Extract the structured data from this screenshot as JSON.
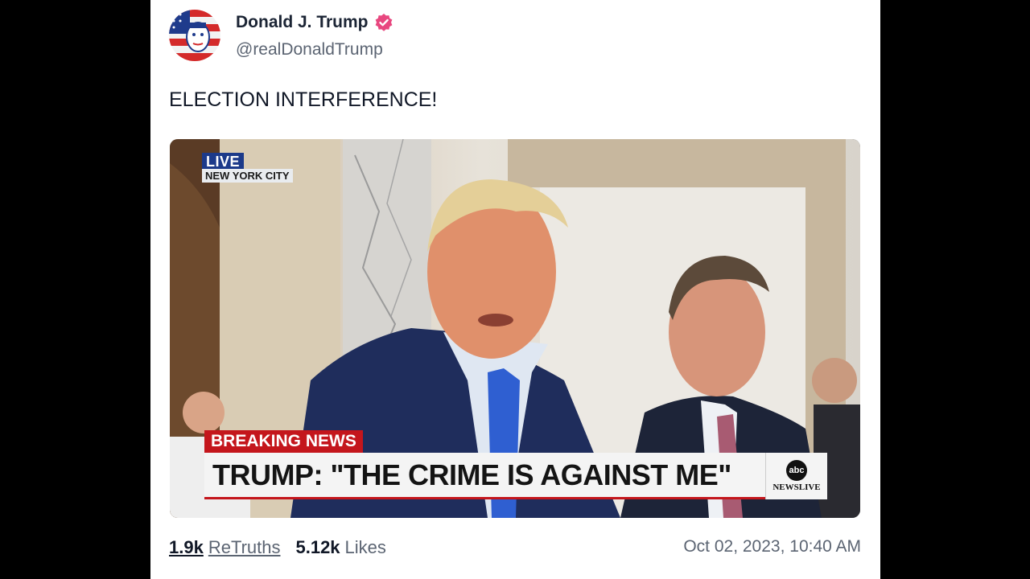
{
  "post": {
    "author_name": "Donald J. Trump",
    "handle": "@realDonaldTrump",
    "text": "ELECTION INTERFERENCE!",
    "media": {
      "live_label": "LIVE",
      "location_label": "NEW YORK CITY",
      "breaking_label": "BREAKING NEWS",
      "headline": "TRUMP: \"THE CRIME IS AGAINST ME\"",
      "network_logo": "abc",
      "network_sub": "NEWSLIVE"
    },
    "stats": {
      "retruths_count": "1.9k",
      "retruths_label": "ReTruths",
      "likes_count": "5.12k",
      "likes_label": "Likes"
    },
    "timestamp": "Oct 02, 2023, 10:40 AM"
  },
  "icons": {
    "verified": "verified-badge-icon",
    "avatar": "flag-portrait-avatar"
  },
  "colors": {
    "verified": "#e8477f",
    "breaking_red": "#c4161c",
    "live_blue": "#1c3a8a",
    "text_muted": "#5b6472"
  }
}
